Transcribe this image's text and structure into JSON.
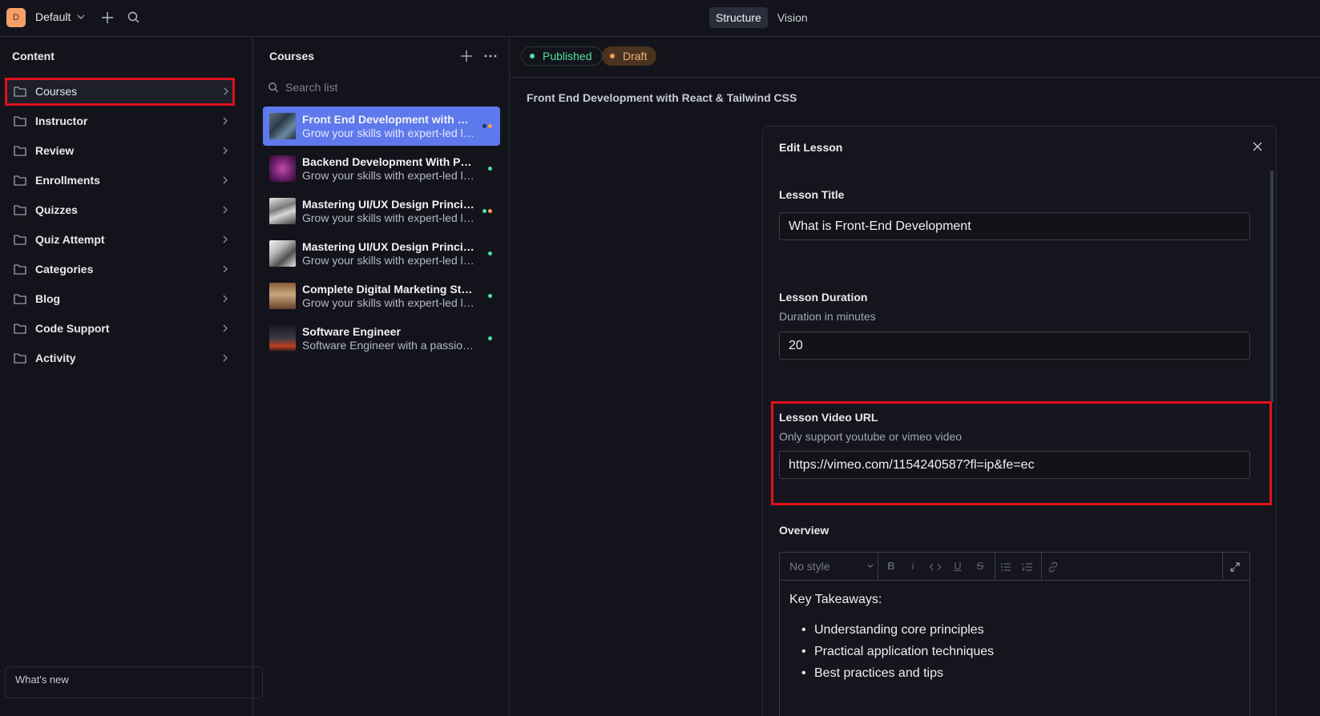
{
  "topbar": {
    "workspace_initial": "D",
    "workspace_name": "Default",
    "modes": [
      "Structure",
      "Vision"
    ]
  },
  "content_pane": {
    "title": "Content",
    "items": [
      {
        "label": "Courses",
        "selected": true
      },
      {
        "label": "Instructor"
      },
      {
        "label": "Review"
      },
      {
        "label": "Enrollments"
      },
      {
        "label": "Quizzes"
      },
      {
        "label": "Quiz Attempt"
      },
      {
        "label": "Categories"
      },
      {
        "label": "Blog"
      },
      {
        "label": "Code Support"
      },
      {
        "label": "Activity"
      }
    ],
    "whats_new": "What's new"
  },
  "courses_pane": {
    "title": "Courses",
    "search_placeholder": "Search list",
    "items": [
      {
        "title": "Front End Development with React & Tailwind CSS",
        "subtitle": "Grow your skills with expert-led learning",
        "status": [
          "published",
          "draft"
        ]
      },
      {
        "title": "Backend Development With Python",
        "subtitle": "Grow your skills with expert-led learning",
        "status": [
          "published"
        ]
      },
      {
        "title": "Mastering UI/UX Design Principles",
        "subtitle": "Grow your skills with expert-led learning",
        "status": [
          "published",
          "draft"
        ]
      },
      {
        "title": "Mastering UI/UX Design Principles",
        "subtitle": "Grow your skills with expert-led learning",
        "status": [
          "published"
        ]
      },
      {
        "title": "Complete Digital Marketing Strategy",
        "subtitle": "Grow your skills with expert-led learning",
        "status": [
          "published"
        ]
      },
      {
        "title": "Software Engineer",
        "subtitle": "Software Engineer with a passion for building",
        "status": [
          "published"
        ]
      }
    ]
  },
  "document": {
    "status_published": "Published",
    "status_draft": "Draft",
    "title": "Front End Development with React & Tailwind CSS"
  },
  "dialog": {
    "title": "Edit Lesson",
    "lesson_title_label": "Lesson Title",
    "lesson_title_value": "What is Front-End Development",
    "duration_label": "Lesson Duration",
    "duration_desc": "Duration in minutes",
    "duration_value": "20",
    "video_label": "Lesson Video URL",
    "video_desc": "Only support youtube or vimeo video",
    "video_value": "https://vimeo.com/1154240587?fl=ip&fe=ec",
    "overview_label": "Overview",
    "style_select": "No style",
    "toolbar": {
      "bold": "B",
      "italic": "i",
      "underline": "U",
      "strike": "S"
    },
    "overview_heading": "Key Takeaways:",
    "overview_bullets": [
      "Understanding core principles",
      "Practical application techniques",
      "Best practices and tips"
    ]
  },
  "colors": {
    "background": "#13141b",
    "accent": "#5e79ec",
    "published": "#4ee0a0",
    "draft": "#f0b070",
    "highlight": "#e0101a"
  }
}
